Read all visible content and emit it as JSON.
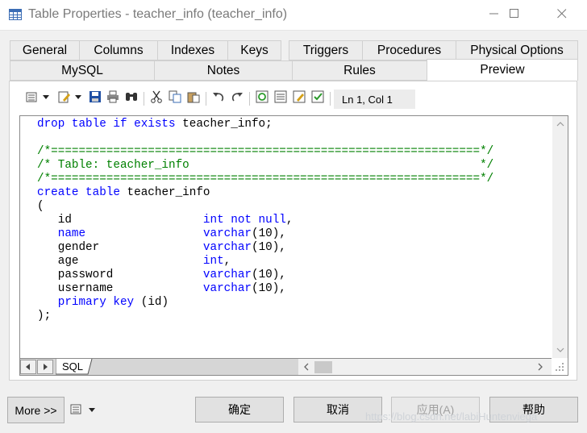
{
  "window": {
    "title": "Table Properties - teacher_info (teacher_info)",
    "icons": [
      "table-icon",
      "minimize-icon",
      "maximize-icon",
      "close-icon"
    ]
  },
  "tabs": {
    "row1": [
      "General",
      "Columns",
      "Indexes",
      "Keys",
      "Triggers",
      "Procedures",
      "Physical Options"
    ],
    "row2": [
      "MySQL",
      "Notes",
      "Rules",
      "Preview"
    ],
    "active": "Preview"
  },
  "toolbar": {
    "position_label": "Ln 1, Col 1",
    "icons": [
      "properties-dropdown-icon",
      "edit-dropdown-icon",
      "save-icon",
      "print-icon",
      "find-icon",
      "cut-icon",
      "copy-icon",
      "paste-icon",
      "undo-icon",
      "redo-icon",
      "refresh-icon",
      "show-generation-options-icon",
      "edit-options-icon",
      "check-options-icon"
    ]
  },
  "editor": {
    "lines": [
      [
        [
          "kw",
          "drop table if exists"
        ],
        [
          "t",
          " teacher_info;"
        ]
      ],
      [
        [
          "t",
          ""
        ]
      ],
      [
        [
          "cm",
          "/*==============================================================*/"
        ]
      ],
      [
        [
          "cm",
          "/* Table: teacher_info                                          */"
        ]
      ],
      [
        [
          "cm",
          "/*==============================================================*/"
        ]
      ],
      [
        [
          "kw",
          "create table"
        ],
        [
          "t",
          " teacher_info"
        ]
      ],
      [
        [
          "t",
          "("
        ]
      ],
      [
        [
          "t",
          "   id                   "
        ],
        [
          "kw",
          "int not null"
        ],
        [
          "t",
          ","
        ]
      ],
      [
        [
          "t",
          "   "
        ],
        [
          "kw",
          "name"
        ],
        [
          "t",
          "                 "
        ],
        [
          "kw",
          "varchar"
        ],
        [
          "t",
          "(10),"
        ]
      ],
      [
        [
          "t",
          "   gender               "
        ],
        [
          "kw",
          "varchar"
        ],
        [
          "t",
          "(10),"
        ]
      ],
      [
        [
          "t",
          "   age                  "
        ],
        [
          "kw",
          "int"
        ],
        [
          "t",
          ","
        ]
      ],
      [
        [
          "t",
          "   password             "
        ],
        [
          "kw",
          "varchar"
        ],
        [
          "t",
          "(10),"
        ]
      ],
      [
        [
          "t",
          "   username             "
        ],
        [
          "kw",
          "varchar"
        ],
        [
          "t",
          "(10),"
        ]
      ],
      [
        [
          "t",
          "   "
        ],
        [
          "kw",
          "primary key"
        ],
        [
          "t",
          " (id)"
        ]
      ],
      [
        [
          "t",
          ");"
        ]
      ]
    ],
    "sheet_tab": "SQL"
  },
  "footer": {
    "more_label": "More >>",
    "ok_label": "确定",
    "cancel_label": "取消",
    "apply_label": "应用(A)",
    "help_label": "帮助"
  },
  "watermark": "https://blog.csdn.net/labiHuntenviega",
  "colors": {
    "keyword": "#0000ff",
    "comment": "#008000",
    "background": "#f0f0f0"
  }
}
